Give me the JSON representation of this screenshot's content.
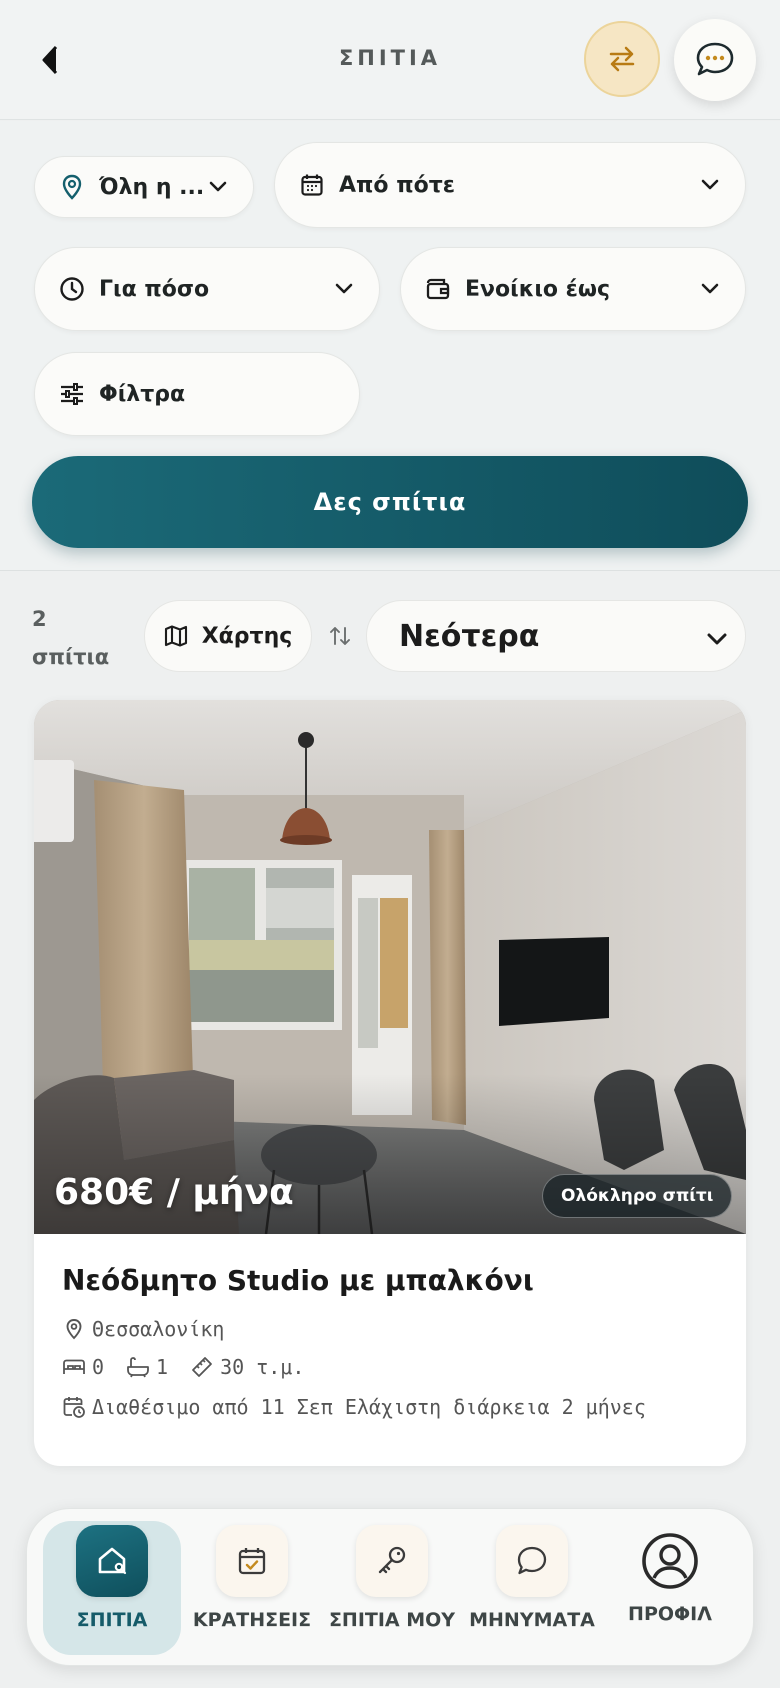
{
  "header": {
    "title": "ΣΠΙΤΙΑ"
  },
  "filters": {
    "location": "Όλη η ...",
    "from": "Από πότε",
    "how_long": "Για πόσο",
    "rent_up_to": "Ενοίκιο έως",
    "filters": "Φίλτρα",
    "cta": "Δες σπίτια"
  },
  "results": {
    "count_number": "2",
    "count_label": "σπίτια",
    "map_label": "Χάρτης",
    "sort_selected": "Νεότερα"
  },
  "listing": {
    "price": "680€ / μήνα",
    "type": "Ολόκληρο σπίτι",
    "title": "Νεόδμητο Studio με μπαλκόνι",
    "city": "Θεσσαλονίκη",
    "bedrooms": "0",
    "bathrooms": "1",
    "area": "30 τ.μ.",
    "availability": "Διαθέσιμο από 11 Σεπ Ελάχιστη διάρκεια 2 μήνες"
  },
  "nav": {
    "homes": "ΣΠΙΤΙΑ",
    "bookings": "ΚΡΑΤΗΣΕΙΣ",
    "my_homes": "ΣΠΙΤΙΑ ΜΟΥ",
    "messages": "ΜΗΝΥΜΑΤΑ",
    "profile": "ΠΡΟΦΙΛ"
  },
  "colors": {
    "primary": "#145f6d",
    "accent_gold": "#c48a1e",
    "background": "#eef0f0"
  },
  "icons": {
    "back": "chevron-left-icon",
    "swap": "swap-arrows-icon",
    "chat": "chat-bubble-icon",
    "location": "location-pin-icon",
    "calendar": "calendar-icon",
    "clock": "clock-icon",
    "wallet": "wallet-icon",
    "sliders": "sliders-icon",
    "map": "map-icon",
    "sort": "sort-arrows-icon"
  }
}
